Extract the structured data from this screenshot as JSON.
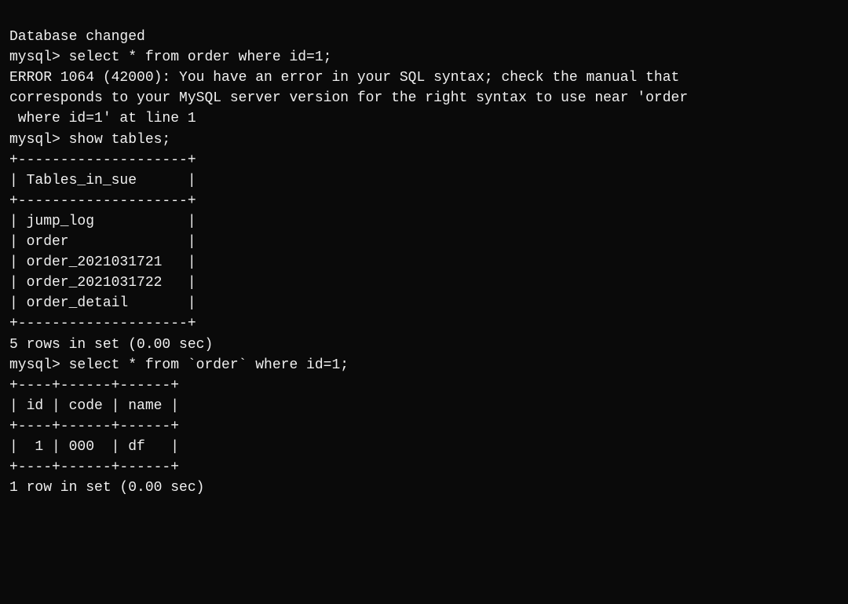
{
  "terminal": {
    "lines": [
      "Database changed",
      "mysql> select * from order where id=1;",
      "ERROR 1064 (42000): You have an error in your SQL syntax; check the manual that",
      "corresponds to your MySQL server version for the right syntax to use near 'order",
      " where id=1' at line 1",
      "mysql> show tables;",
      "+--------------------+",
      "| Tables_in_sue      |",
      "+--------------------+",
      "| jump_log           |",
      "| order              |",
      "| order_2021031721   |",
      "| order_2021031722   |",
      "| order_detail       |",
      "+--------------------+",
      "5 rows in set (0.00 sec)",
      "",
      "mysql> select * from `order` where id=1;",
      "+----+------+------+",
      "| id | code | name |",
      "+----+------+------+",
      "|  1 | 000  | df   |",
      "+----+------+------+",
      "1 row in set (0.00 sec)"
    ]
  }
}
